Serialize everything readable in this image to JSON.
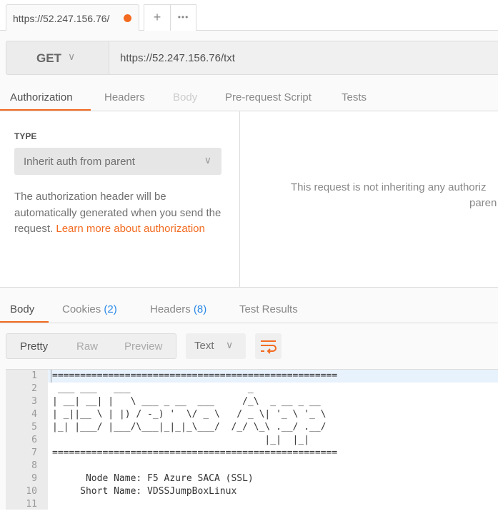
{
  "tabbar": {
    "tab_title": "https://52.247.156.76/",
    "add_icon": "+",
    "more_icon": "•••",
    "unsaved_color": "#f26b21"
  },
  "request": {
    "method": "GET",
    "url": "https://52.247.156.76/txt"
  },
  "request_tabs": [
    {
      "label": "Authorization",
      "active": true
    },
    {
      "label": "Headers"
    },
    {
      "label": "Body",
      "disabled": true
    },
    {
      "label": "Pre-request Script"
    },
    {
      "label": "Tests"
    }
  ],
  "auth": {
    "type_label": "TYPE",
    "type_value": "Inherit auth from parent",
    "description": "The authorization header will be automatically generated when you send the request. ",
    "link": "Learn more about authorization",
    "right_line1": "This request is not inheriting any authoriz",
    "right_line2": "paren"
  },
  "response_tabs": [
    {
      "label": "Body",
      "active": true
    },
    {
      "label": "Cookies",
      "count": "(2)"
    },
    {
      "label": "Headers",
      "count": "(8)"
    },
    {
      "label": "Test Results"
    }
  ],
  "view": {
    "pretty": "Pretty",
    "raw": "Raw",
    "preview": "Preview",
    "format": "Text",
    "wrap_icon": "wrap-lines-icon"
  },
  "accent": "#f26b21",
  "code_lines": [
    "===================================================",
    " ___ ___   ___                     _",
    "| __| __| |   \\ ___ _ __  ___     /_\\  _ __ _ __",
    "| _||__ \\ | |) / -_) '  \\/ _ \\   / _ \\| '_ \\ '_ \\",
    "|_| |___/ |___/\\___|_|_|_\\___/  /_/ \\_\\ .__/ .__/",
    "                                      |_|  |_|",
    "===================================================",
    "",
    "      Node Name: F5 Azure SACA (SSL)",
    "     Short Name: VDSSJumpBoxLinux",
    ""
  ],
  "line_numbers": [
    "1",
    "2",
    "3",
    "4",
    "5",
    "6",
    "7",
    "8",
    "9",
    "10",
    "11"
  ]
}
